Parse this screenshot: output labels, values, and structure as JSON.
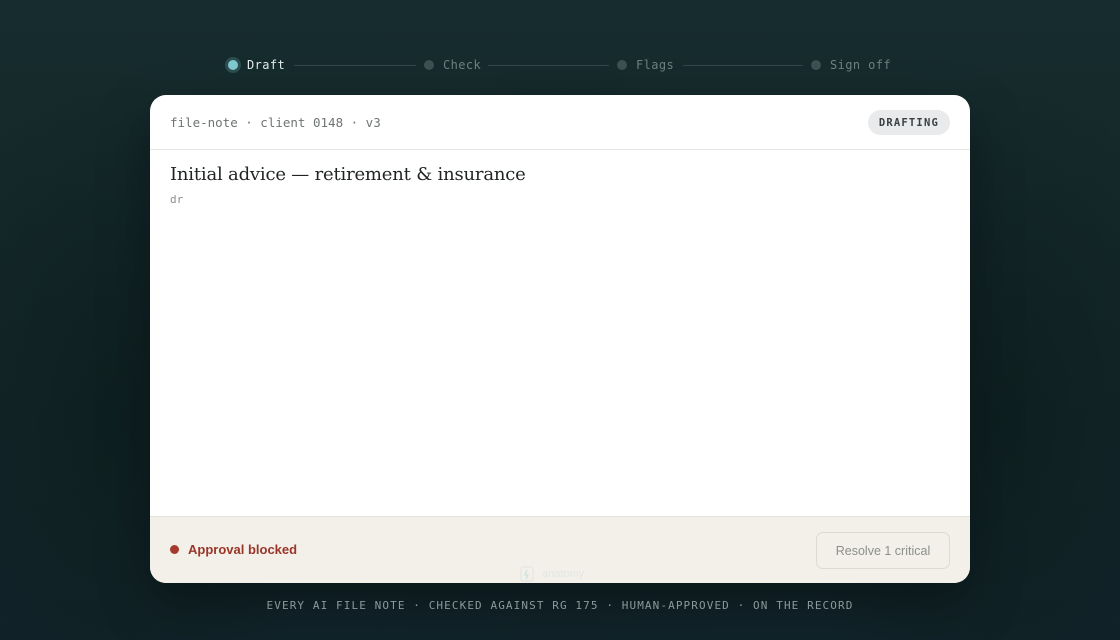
{
  "stepper": {
    "steps": [
      {
        "label": "Draft",
        "active": true
      },
      {
        "label": "Check",
        "active": false
      },
      {
        "label": "Flags",
        "active": false
      },
      {
        "label": "Sign off",
        "active": false
      }
    ]
  },
  "card": {
    "file_meta": "file-note · client 0148 · v3",
    "status_badge": "DRAFTING",
    "title": "Initial advice — retirement & insurance",
    "body_text": "dr"
  },
  "footer": {
    "blocked_label": "Approval blocked",
    "resolve_button": "Resolve 1 critical"
  },
  "brand": {
    "name": "anatomy"
  },
  "tagline": "EVERY AI FILE NOTE · CHECKED AGAINST RG 175 · HUMAN-APPROVED · ON THE RECORD",
  "colors": {
    "background": "#15292a",
    "accent_active": "#7fc9cf",
    "blocked_red": "#9a3528",
    "footer_bg": "#f2f0e9"
  },
  "icons": {
    "step_dot": "circle-dot-icon",
    "blocked_dot": "status-dot-icon",
    "brand": "brand-logo-icon"
  }
}
